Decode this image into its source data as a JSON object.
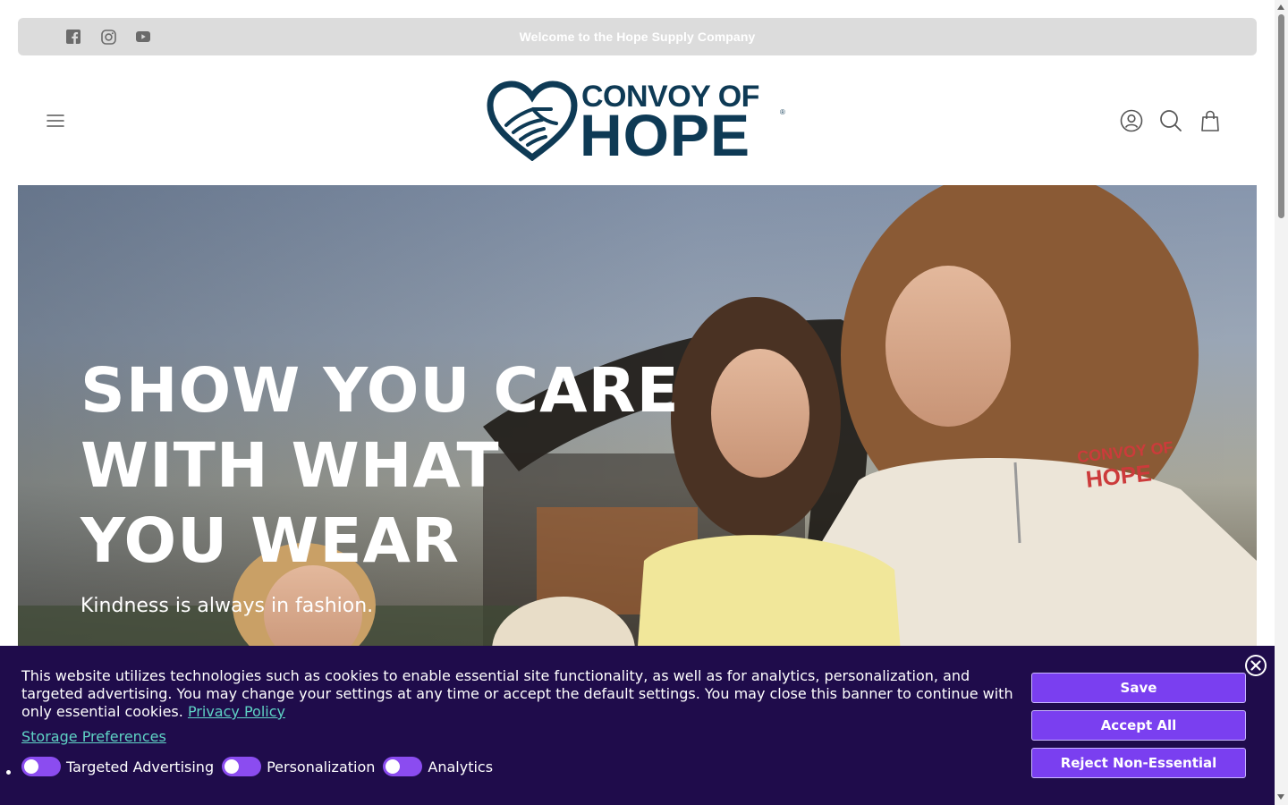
{
  "announcement": {
    "text": "Welcome to the Hope Supply Company",
    "social_icons": [
      "facebook-icon",
      "instagram-icon",
      "youtube-icon"
    ],
    "background": "#dcdcdc"
  },
  "header": {
    "logo": {
      "line1": "CONVOY OF",
      "line2": "HOPE",
      "mark": "®",
      "color": "#0e3a55"
    },
    "icons": [
      "menu-icon",
      "account-icon",
      "search-icon",
      "cart-icon"
    ]
  },
  "hero": {
    "title_lines": [
      "SHOW YOU CARE",
      "WITH WHAT",
      "YOU WEAR"
    ],
    "subtitle": "Kindness is always in fashion."
  },
  "cookie_banner": {
    "message": "This website utilizes technologies such as cookies to enable essential site functionality, as well as for analytics, personalization, and targeted advertising. You may change your settings at any time or accept the default settings. You may close this banner to continue with only essential cookies.",
    "privacy_link": "Privacy Policy",
    "storage_link": "Storage Preferences",
    "toggles": [
      {
        "label": "Targeted Advertising",
        "on": false
      },
      {
        "label": "Personalization",
        "on": false
      },
      {
        "label": "Analytics",
        "on": false
      }
    ],
    "buttons": {
      "save": "Save",
      "accept_all": "Accept All",
      "reject": "Reject Non-Essential"
    },
    "background": "#1f0c4b",
    "accent": "#7a3ff0",
    "link_color": "#5fd3c5"
  }
}
